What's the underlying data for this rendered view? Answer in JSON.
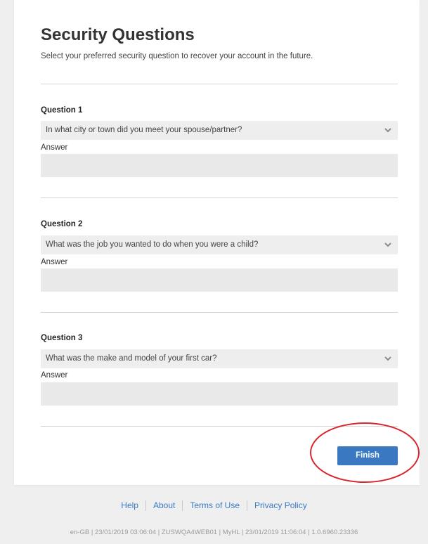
{
  "header": {
    "title": "Security Questions",
    "subtitle": "Select your preferred security question to recover your account in the future."
  },
  "questions": [
    {
      "label": "Question 1",
      "selected": "In what city or town did you meet your spouse/partner?",
      "answer_label": "Answer",
      "answer_value": ""
    },
    {
      "label": "Question 2",
      "selected": "What was the job you wanted to do when you were a child?",
      "answer_label": "Answer",
      "answer_value": ""
    },
    {
      "label": "Question 3",
      "selected": "What was the make and model of your first car?",
      "answer_label": "Answer",
      "answer_value": ""
    }
  ],
  "actions": {
    "finish_label": "Finish"
  },
  "footer": {
    "links": [
      "Help",
      "About",
      "Terms of Use",
      "Privacy Policy"
    ],
    "build_info": "en-GB | 23/01/2019 03:06:04 | ZUSWQA4WEB01 | MyHL | 23/01/2019 11:06:04 | 1.0.6960.23336"
  },
  "colors": {
    "page_background": "#efefef",
    "card_background": "#ffffff",
    "field_background": "#eeeeee",
    "accent": "#3b78c2",
    "link": "#3a78c3",
    "annotation": "#d9262c"
  },
  "icons": {
    "dropdown": "chevron-down-icon"
  }
}
